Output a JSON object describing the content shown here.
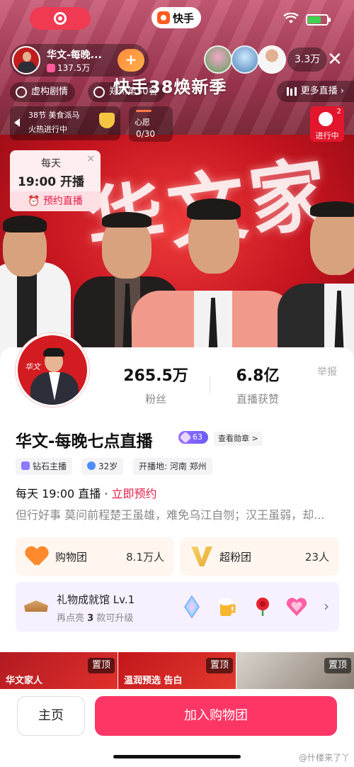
{
  "status_bar": {
    "app_name": "快手"
  },
  "host": {
    "name": "华文-每晚...",
    "likes": "137.5万",
    "follow_icon": "+"
  },
  "viewers": {
    "count": "3.3万"
  },
  "chips": {
    "story": "虚构剧情",
    "location": "郑州第50名"
  },
  "banner": {
    "title": "快手38焕新季"
  },
  "more_live": {
    "label": "更多直播"
  },
  "rank_widget": {
    "line1": "38节 美食派马",
    "line2": "火热进行中"
  },
  "wish_widget": {
    "label": "心愿",
    "count": "0/30"
  },
  "live_now": {
    "label": "进行中",
    "badge": "2"
  },
  "stream_text": {
    "calligraphy": "华文家"
  },
  "reminder": {
    "line1": "每天",
    "time": "19:00 开播",
    "button": "预约直播",
    "close": "×"
  },
  "profile": {
    "fans_value": "265.5万",
    "fans_label": "粉丝",
    "likes_value": "6.8亿",
    "likes_label": "直播获赞",
    "report_label": "举报",
    "name": "华文-每晚七点直播",
    "level": "63",
    "medal_link": "查看勋章 >",
    "tags": [
      "钻石主播",
      "32岁",
      "开播地: 河南 郑州"
    ],
    "schedule": "每天 19:00 直播 · ",
    "schedule_cta": "立即预约",
    "motto": "但行好事 莫问前程楚王虽雄，难免乌江自刎；汉王虽弱，却..."
  },
  "cards": {
    "shopping": {
      "name": "购物团",
      "value": "8.1万人"
    },
    "fans": {
      "name": "超粉团",
      "value": "23人"
    }
  },
  "gift_hall": {
    "title": "礼物成就馆 Lv.1",
    "sub_prefix": "再点亮",
    "sub_count": "3",
    "sub_suffix": "款可升级"
  },
  "thumbnails": [
    {
      "pin": "置顶",
      "caption": "华文家人"
    },
    {
      "pin": "置顶",
      "caption": "温润预选 告白"
    },
    {
      "pin": "置顶",
      "caption": ""
    }
  ],
  "footer": {
    "home": "主页",
    "join": "加入购物团",
    "watermark": "@什楼来了丫"
  },
  "colors": {
    "accent": "#fe3666",
    "brand_red": "#d31c21",
    "orange": "#ff8a2d"
  }
}
